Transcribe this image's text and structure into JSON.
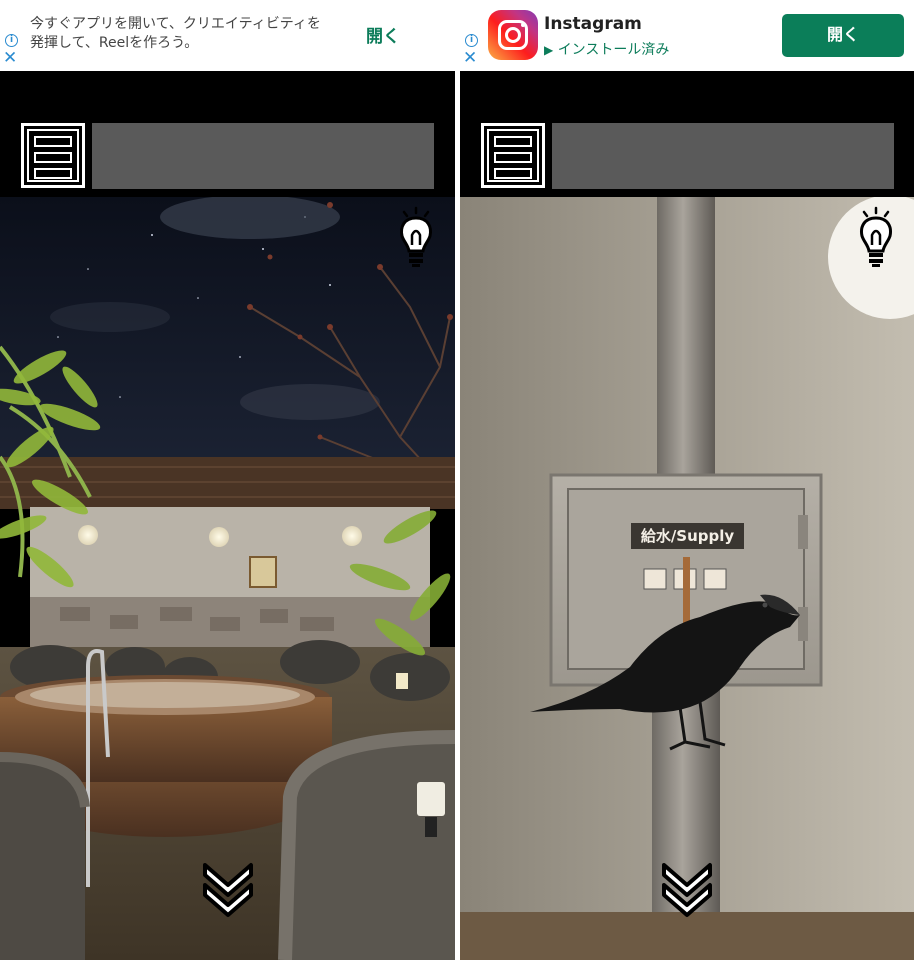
{
  "left_ad": {
    "text": "今すぐアプリを開いて、クリエイティビティを発揮して、Reelを作ろう。",
    "open_label": "開く",
    "info_glyph": "i",
    "close_glyph": "✕"
  },
  "right_ad": {
    "app_name": "Instagram",
    "status": "インストール済み",
    "open_label": "開く",
    "info_glyph": "i",
    "close_glyph": "✕"
  },
  "right_scene": {
    "valve_label": "給水/Supply"
  },
  "colors": {
    "ad_accent": "#0b7e59",
    "item_box": "#5a5a5a",
    "background": "#000000"
  },
  "icons": [
    "menu-icon",
    "hint-lightbulb-icon",
    "chevron-double-down-icon",
    "instagram-logo-icon",
    "info-icon",
    "close-icon",
    "play-store-icon"
  ]
}
